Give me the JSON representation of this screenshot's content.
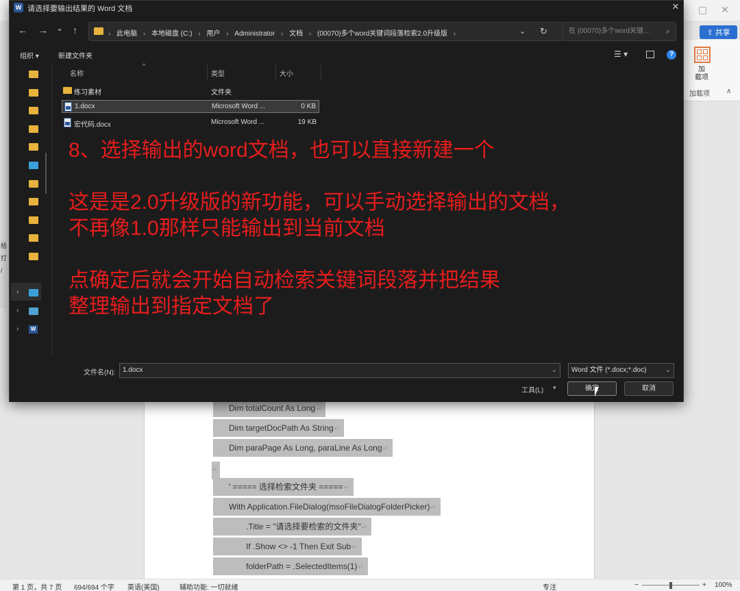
{
  "dialog": {
    "title": "请选择要输出结果的 Word 文档",
    "title_icon": "W",
    "close_glyph": "✕",
    "nav": {
      "back": "←",
      "forward": "→",
      "recent": "⌄",
      "up": "↑"
    },
    "address": [
      "此电脑",
      "本地磁盘 (C:)",
      "用户",
      "Administrator",
      "文档",
      "(00070)多个word关键词段落检索2.0升级版"
    ],
    "address_sep": "›",
    "address_drop": "⌄",
    "refresh": "↻",
    "search_placeholder": "在 (00070)多个word关键...",
    "search_glyph": "⌕",
    "toolbar": {
      "organize": "组织 ▾",
      "new_folder": "新建文件夹",
      "view": "☰ ▾",
      "help": "?"
    },
    "columns": {
      "name": "名称",
      "type": "类型",
      "size": "大小",
      "sort": "^"
    },
    "files": [
      {
        "name": "练习素材",
        "type": "文件夹",
        "size": "",
        "icon": "folder-icon"
      },
      {
        "name": "1.docx",
        "type": "Microsoft Word ...",
        "size": "0 KB",
        "icon": "word-doc-icon"
      },
      {
        "name": "宏代码.docx",
        "type": "Microsoft Word ...",
        "size": "19 KB",
        "icon": "word-doc-icon"
      }
    ],
    "nav_expand_glyph": "›",
    "nav_word_glyph": "W",
    "annotation": [
      "8、选择输出的word文档，也可以直接新建一个",
      "",
      "这是是2.0升级版的新功能，可以手动选择输出的文档，",
      "不再像1.0那样只能输出到当前文档",
      "",
      "点确定后就会开始自动检索关键词段落并把结果",
      "整理输出到指定文档了"
    ],
    "filename_label": "文件名(N):",
    "filename_value": "1.docx",
    "filename_drop": "⌄",
    "filter": "Word 文件 (*.docx;*.doc)",
    "filter_drop": "⌄",
    "tools": "工具(L)",
    "tools_drop": "▾",
    "ok": "确定",
    "cancel": "取消"
  },
  "word": {
    "share": "共享",
    "share_icon": "⇪",
    "win_min": "▢",
    "win_close": "✕",
    "addin_label": "加\n载项",
    "addin_group": "加载项",
    "addin_collapse": "∧",
    "left_strip": [
      "栝",
      "打",
      "/"
    ],
    "code_lines": [
      "Dim totalCount As Long",
      "Dim targetDocPath As String",
      "Dim paraPage As Long, paraLine As Long",
      "' =====  选择检索文件夹  =====",
      "With Application.FileDialog(msoFileDialogFolderPicker)",
      ".Title = \"请选择要检索的文件夹\"",
      "If .Show <> -1 Then Exit Sub",
      "folderPath = .SelectedItems(1)"
    ],
    "para_mark": "↵",
    "status": {
      "page": "第 1 页，共 7 页",
      "words": "694/694 个字",
      "language": "英语(美国)",
      "accessibility": "辅助功能: 一切就绪",
      "focus": "专注",
      "zoom_minus": "−",
      "zoom_plus": "+",
      "zoom": "100%"
    }
  }
}
